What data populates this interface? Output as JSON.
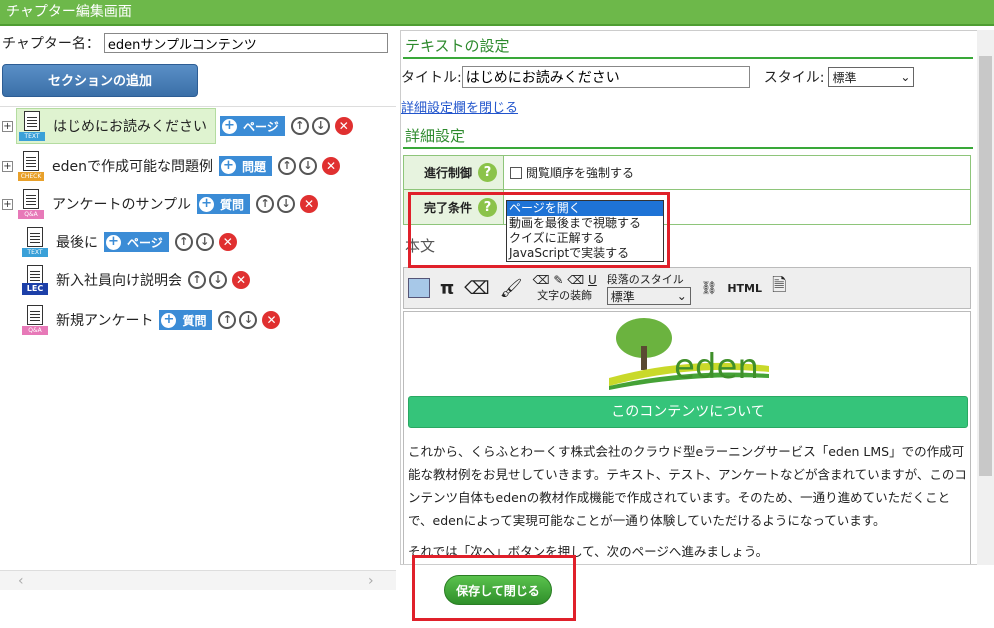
{
  "window": {
    "title": "チャプター編集画面"
  },
  "chapter": {
    "label": "チャプター名：",
    "value": "edenサンプルコンテンツ"
  },
  "add_section_label": "セクションの追加",
  "tree": [
    {
      "label": "はじめにお読みください",
      "tag": "TEXT",
      "button": "ページ"
    },
    {
      "label": "edenで作成可能な問題例",
      "tag": "CHECK",
      "button": "問題"
    },
    {
      "label": "アンケートのサンプル",
      "tag": "Q&A",
      "button": "質問"
    },
    {
      "label": "最後に",
      "tag": "TEXT",
      "button": "ページ"
    },
    {
      "label": "新入社員向け説明会",
      "tag": "LEC",
      "button": ""
    },
    {
      "label": "新規アンケート",
      "tag": "Q&A",
      "button": "質問"
    }
  ],
  "text_settings": {
    "heading": "テキストの設定",
    "title_label": "タイトル:",
    "title_value": "はじめにお読みください",
    "style_label": "スタイル:",
    "style_value": "標準",
    "close_link": "詳細設定欄を閉じる"
  },
  "detail": {
    "heading": "詳細設定",
    "progress_label": "進行制御",
    "progress_checkbox": "閲覧順序を強制する",
    "complete_label": "完了条件",
    "options": [
      "ページを開く",
      "動画を最後まで視聴する",
      "クイズに正解する",
      "JavaScriptで実装する"
    ]
  },
  "body_heading": "本文",
  "toolbar": {
    "decoration": "文字の装飾",
    "paragraph": "段落のスタイル",
    "paragraph_value": "標準",
    "html": "HTML"
  },
  "editor": {
    "logo_text": "eden",
    "banner": "このコンテンツについて",
    "para1": "これから、くらふとわーくす株式会社のクラウド型eラーニングサービス「eden LMS」での作成可能な教材例をお見せしていきます。テキスト、テスト、アンケートなどが含まれていますが、このコンテンツ自体もedenの教材作成機能で作成されています。そのため、一通り進めていただくことで、edenによって実現可能なことが一通り体験していただけるようになっています。",
    "para2": "それでは「次へ」ボタンを押して、次のページへ進みましょう。"
  },
  "save_button": "保存して閉じる",
  "colors": {
    "accent": "#6db84a",
    "highlight": "#e0202a",
    "link": "#2255cc"
  }
}
